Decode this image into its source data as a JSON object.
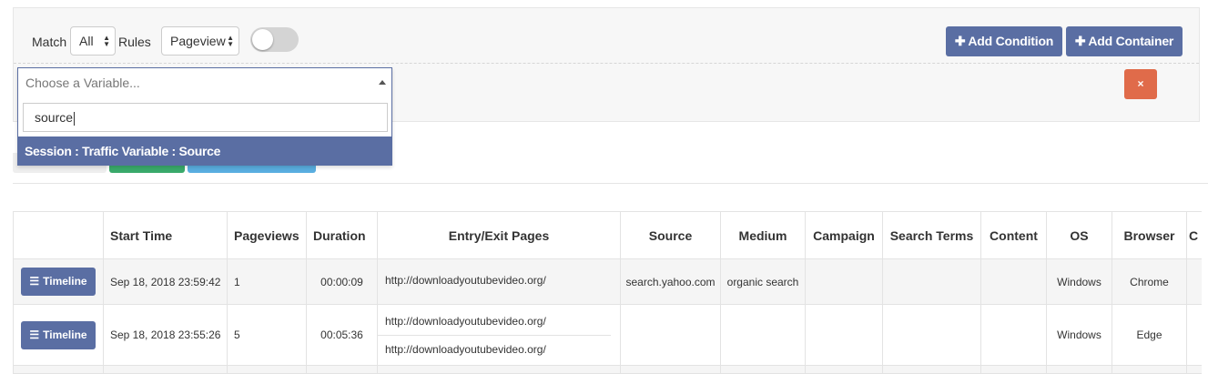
{
  "filter": {
    "match_label": "Match",
    "match_value": "All",
    "rules_label": "Rules",
    "type_value": "Pageview",
    "add_condition_label": "Add Condition",
    "add_container_label": "Add Container",
    "remove_icon": "×"
  },
  "variable_dropdown": {
    "placeholder": "Choose a Variable...",
    "search_value": "source",
    "result_label": "Session : Traffic Variable : Source"
  },
  "table": {
    "headers": [
      "",
      "Start Time",
      "Pageviews",
      "Duration",
      "Entry/Exit Pages",
      "Source",
      "Medium",
      "Campaign",
      "Search Terms",
      "Content",
      "OS",
      "Browser",
      "C"
    ],
    "timeline_label": "Timeline",
    "rows": [
      {
        "start_time": "Sep 18, 2018 23:59:42",
        "pageviews": "1",
        "duration": "00:00:09",
        "pages": [
          "http://downloadyoutubevideo.org/"
        ],
        "source": "search.yahoo.com",
        "medium": "organic search",
        "campaign": "",
        "search_terms": "",
        "content": "",
        "os": "Windows",
        "browser": "Chrome"
      },
      {
        "start_time": "Sep 18, 2018 23:55:26",
        "pageviews": "5",
        "duration": "00:05:36",
        "pages": [
          "http://downloadyoutubevideo.org/",
          "http://downloadyoutubevideo.org/"
        ],
        "source": "",
        "medium": "",
        "campaign": "",
        "search_terms": "",
        "content": "",
        "os": "Windows",
        "browser": "Edge"
      }
    ]
  },
  "colors": {
    "primary": "#5a6ea3",
    "danger": "#e06b4a",
    "success": "#3aaa6b",
    "info": "#59aee0"
  }
}
